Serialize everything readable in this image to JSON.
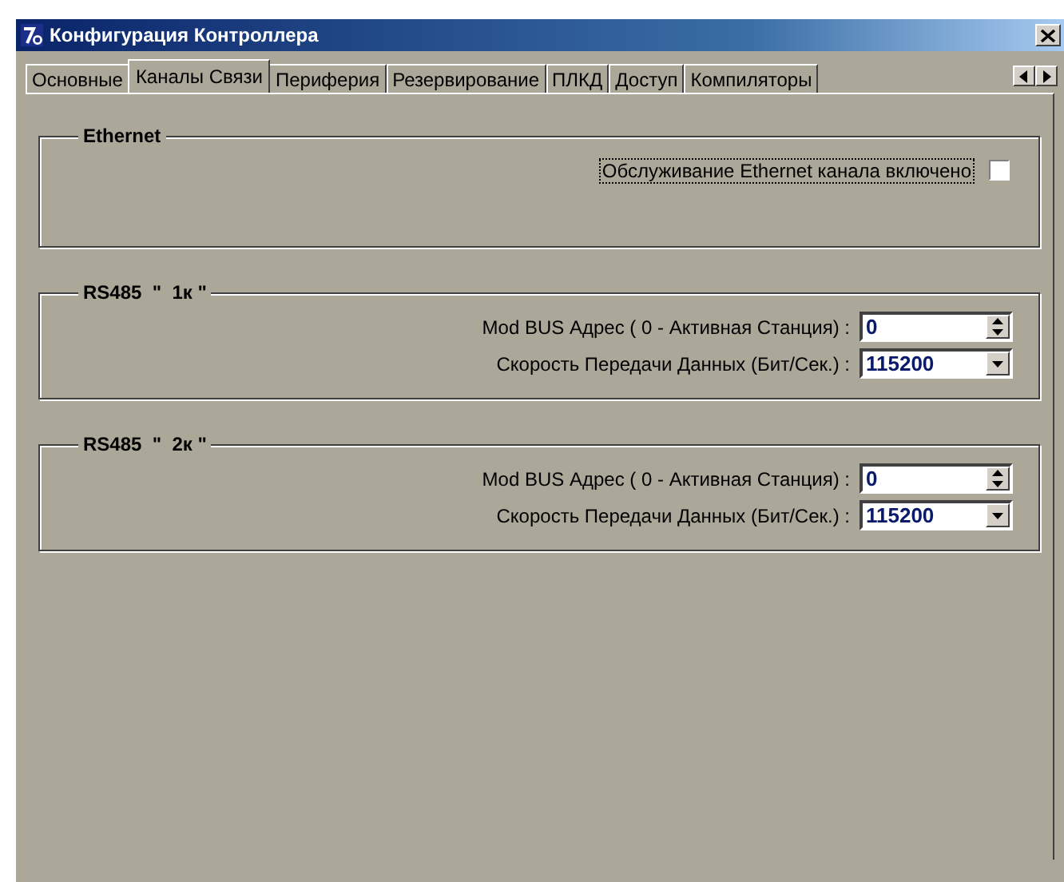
{
  "window": {
    "title": "Конфигурация Контроллера"
  },
  "tabs": [
    {
      "label": "Основные",
      "selected": false
    },
    {
      "label": "Каналы Связи",
      "selected": true
    },
    {
      "label": "Периферия",
      "selected": false
    },
    {
      "label": "Резервирование",
      "selected": false
    },
    {
      "label": "ПЛКД",
      "selected": false
    },
    {
      "label": "Доступ",
      "selected": false
    },
    {
      "label": "Компиляторы",
      "selected": false
    }
  ],
  "groups": [
    {
      "title": "Ethernet",
      "rows": [
        {
          "kind": "checkbox",
          "label": "Обслуживание Ethernet канала включено",
          "checked": false,
          "focused": true
        }
      ]
    },
    {
      "title": "RS485  \"  1к \"",
      "rows": [
        {
          "kind": "spin",
          "label": "Mod BUS Адрес ( 0 - Активная Станция) :",
          "value": "0"
        },
        {
          "kind": "combo",
          "label": "Скорость Передачи Данных (Бит/Сек.) :",
          "value": "115200"
        }
      ]
    },
    {
      "title": "RS485  \"  2к \"",
      "rows": [
        {
          "kind": "spin",
          "label": "Mod BUS Адрес ( 0 - Активная Станция) :",
          "value": "0"
        },
        {
          "kind": "combo",
          "label": "Скорость Передачи Данных (Бит/Сек.) :",
          "value": "115200"
        }
      ]
    }
  ]
}
